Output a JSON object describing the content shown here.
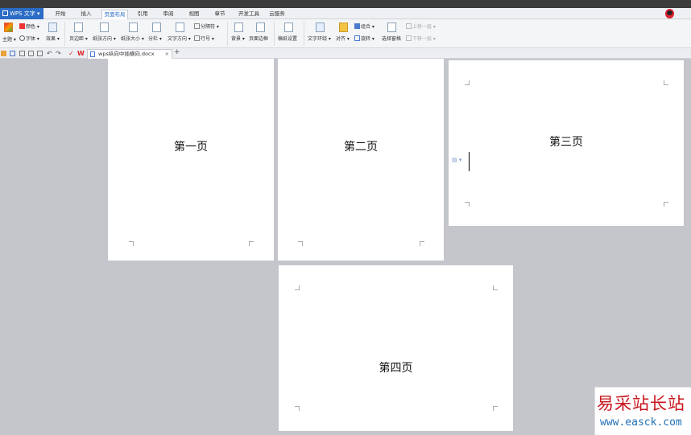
{
  "app": {
    "name": "WPS 文字"
  },
  "menu_tabs": [
    "开始",
    "插入",
    "页面布局",
    "引用",
    "审阅",
    "视图",
    "章节",
    "开发工具",
    "云服务"
  ],
  "active_tab": "页面布局",
  "ribbon": {
    "theme": "主题",
    "color": "颜色",
    "font": "字体",
    "effect": "效果",
    "margins": "页边距",
    "orientation": "纸张方向",
    "size": "纸张大小",
    "columns": "分栏",
    "text_direction": "文字方向",
    "breaks": "分隔符",
    "line_numbers": "行号",
    "background": "背景",
    "page_border": "页面边框",
    "draft_settings": "稿纸设置",
    "text_wrap": "文字环绕",
    "align": "对齐",
    "group": "组合",
    "rotate": "旋转",
    "selection_pane": "选择窗格",
    "bring_forward": "上移一层",
    "send_backward": "下移一层"
  },
  "document_tab": {
    "name": "wps纵向中插横向.docx"
  },
  "pages": [
    {
      "title": "第一页"
    },
    {
      "title": "第二页"
    },
    {
      "title": "第三页"
    },
    {
      "title": "第四页"
    }
  ],
  "watermark": {
    "main": "易采站长站",
    "sub": "www.easck.com"
  },
  "colors": {
    "accent": "#2b6cc4",
    "workspace": "#c4c6cc",
    "watermark_red": "#c8161d",
    "watermark_blue": "#1f6fb5"
  }
}
